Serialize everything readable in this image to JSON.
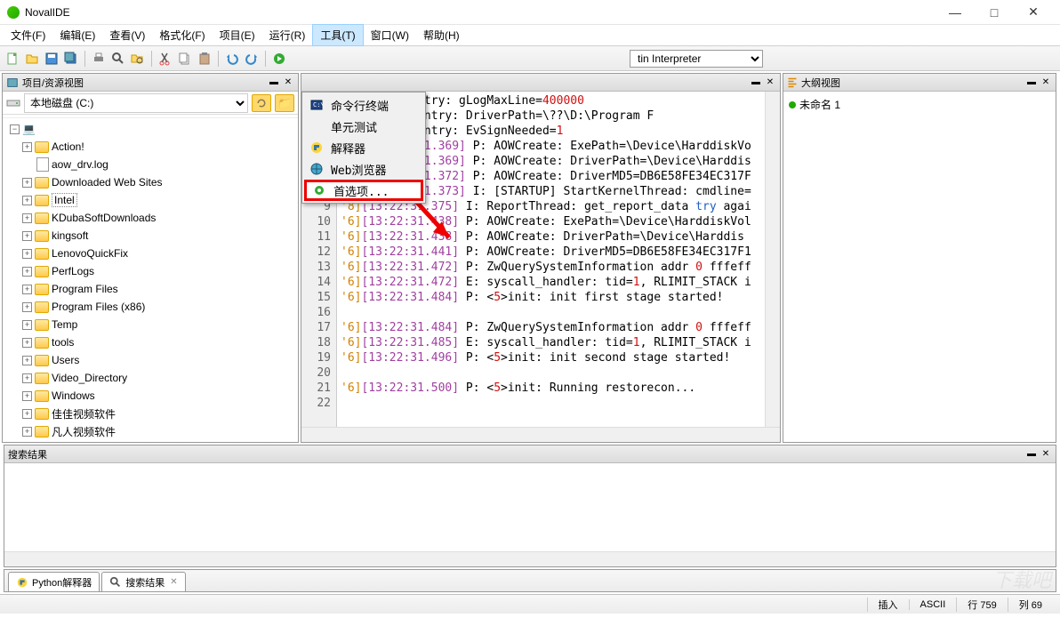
{
  "window": {
    "title": "NovalIDE"
  },
  "menubar": [
    "文件(F)",
    "编辑(E)",
    "查看(V)",
    "格式化(F)",
    "项目(E)",
    "运行(R)",
    "工具(T)",
    "窗口(W)",
    "帮助(H)"
  ],
  "menubar_active_index": 6,
  "interpreter": {
    "selected": "tin Interpreter"
  },
  "dropdown": {
    "items": [
      {
        "label": "命令行终端",
        "icon": "terminal"
      },
      {
        "label": "单元测试",
        "icon": ""
      },
      {
        "label": "解释器",
        "icon": "python"
      },
      {
        "label": "Web浏览器",
        "icon": "globe"
      },
      {
        "label": "首选项...",
        "icon": "pref",
        "highlighted": true
      }
    ]
  },
  "left_panel": {
    "title": "项目/资源视图",
    "drive": "本地磁盘 (C:)",
    "items": [
      {
        "label": "Action!",
        "type": "folder",
        "expandable": true
      },
      {
        "label": "aow_drv.log",
        "type": "file",
        "expandable": false
      },
      {
        "label": "Downloaded Web Sites",
        "type": "folder",
        "expandable": true
      },
      {
        "label": "Intel",
        "type": "folder",
        "expandable": true,
        "selected": true
      },
      {
        "label": "KDubaSoftDownloads",
        "type": "folder",
        "expandable": true
      },
      {
        "label": "kingsoft",
        "type": "folder",
        "expandable": true
      },
      {
        "label": "LenovoQuickFix",
        "type": "folder",
        "expandable": true
      },
      {
        "label": "PerfLogs",
        "type": "folder",
        "expandable": true
      },
      {
        "label": "Program Files",
        "type": "folder",
        "expandable": true
      },
      {
        "label": "Program Files (x86)",
        "type": "folder",
        "expandable": true
      },
      {
        "label": "Temp",
        "type": "folder",
        "expandable": true
      },
      {
        "label": "tools",
        "type": "folder",
        "expandable": true
      },
      {
        "label": "Users",
        "type": "folder",
        "expandable": true
      },
      {
        "label": "Video_Directory",
        "type": "folder",
        "expandable": true
      },
      {
        "label": "Windows",
        "type": "folder",
        "expandable": true
      },
      {
        "label": "佳佳视频软件",
        "type": "folder",
        "expandable": true
      },
      {
        "label": "凡人视频软件",
        "type": "folder",
        "expandable": true
      }
    ]
  },
  "outline": {
    "title": "大纲视图",
    "item": "未命名 1"
  },
  "editor": {
    "first_line": 2,
    "lines": [
      {
        "pre": "",
        "ts": "",
        "body_parts": [
          [
            " P: DriverEntry: gLogMaxLine=",
            "black"
          ],
          [
            "400000",
            "red"
          ]
        ]
      },
      {
        "pre": "",
        "ts": "",
        "body_parts": [
          [
            "] P: DriverEntry: DriverPath=\\??\\D:\\Program F",
            "black"
          ]
        ]
      },
      {
        "pre": "",
        "ts": "",
        "body_parts": [
          [
            "] P: DriverEntry: EvSignNeeded=",
            "black"
          ],
          [
            "1",
            "red"
          ]
        ]
      },
      {
        "pre": "'80]",
        "ts": "[13:22:31.369]",
        "body_parts": [
          [
            " P: AOWCreate: ExePath=\\Device\\HarddiskVo",
            "black"
          ]
        ]
      },
      {
        "pre": "'80]",
        "ts": "[13:22:31.369]",
        "body_parts": [
          [
            " P: AOWCreate: DriverPath=\\Device\\Harddis",
            "black"
          ]
        ]
      },
      {
        "pre": "'80]",
        "ts": "[13:22:31.372]",
        "body_parts": [
          [
            " P: AOWCreate: DriverMD5=DB6E58FE34EC317F",
            "black"
          ]
        ]
      },
      {
        "pre": "'80]",
        "ts": "[13:22:31.373]",
        "body_parts": [
          [
            " I: [STARTUP] StartKernelThread: cmdline=",
            "black"
          ]
        ]
      },
      {
        "pre": "'8]",
        "ts": "[13:22:31.375]",
        "body_parts": [
          [
            " I: ReportThread: get_report_data ",
            "black"
          ],
          [
            "try",
            "blue"
          ],
          [
            " agai",
            "black"
          ]
        ]
      },
      {
        "pre": "'6]",
        "ts": "[13:22:31.438]",
        "body_parts": [
          [
            " P: AOWCreate: ExePath=\\Device\\HarddiskVol",
            "black"
          ]
        ]
      },
      {
        "pre": "'6]",
        "ts": "[13:22:31.438]",
        "body_parts": [
          [
            " P: AOWCreate: DriverPath=\\Device\\Harddis",
            "black"
          ]
        ]
      },
      {
        "pre": "'6]",
        "ts": "[13:22:31.441]",
        "body_parts": [
          [
            " P: AOWCreate: DriverMD5=DB6E58FE34EC317F1",
            "black"
          ]
        ]
      },
      {
        "pre": "'6]",
        "ts": "[13:22:31.472]",
        "body_parts": [
          [
            " P: ZwQuerySystemInformation addr ",
            "black"
          ],
          [
            "0",
            "red"
          ],
          [
            " fffeff",
            "black"
          ]
        ]
      },
      {
        "pre": "'6]",
        "ts": "[13:22:31.472]",
        "body_parts": [
          [
            " E: syscall_handler: tid=",
            "black"
          ],
          [
            "1",
            "red"
          ],
          [
            ", RLIMIT_STACK i",
            "black"
          ]
        ]
      },
      {
        "pre": "'6]",
        "ts": "[13:22:31.484]",
        "body_parts": [
          [
            " P: <",
            "black"
          ],
          [
            "5",
            "red"
          ],
          [
            ">init: init first stage started!",
            "black"
          ]
        ]
      },
      {
        "pre": "",
        "ts": "",
        "body_parts": [
          [
            "",
            "black"
          ]
        ]
      },
      {
        "pre": "'6]",
        "ts": "[13:22:31.484]",
        "body_parts": [
          [
            " P: ZwQuerySystemInformation addr ",
            "black"
          ],
          [
            "0",
            "red"
          ],
          [
            " fffeff",
            "black"
          ]
        ]
      },
      {
        "pre": "'6]",
        "ts": "[13:22:31.485]",
        "body_parts": [
          [
            " E: syscall_handler: tid=",
            "black"
          ],
          [
            "1",
            "red"
          ],
          [
            ", RLIMIT_STACK i",
            "black"
          ]
        ]
      },
      {
        "pre": "'6]",
        "ts": "[13:22:31.496]",
        "body_parts": [
          [
            " P: <",
            "black"
          ],
          [
            "5",
            "red"
          ],
          [
            ">init: init second stage started!",
            "black"
          ]
        ]
      },
      {
        "pre": "",
        "ts": "",
        "body_parts": [
          [
            "",
            "black"
          ]
        ]
      },
      {
        "pre": "'6]",
        "ts": "[13:22:31.500]",
        "body_parts": [
          [
            " P: <",
            "black"
          ],
          [
            "5",
            "red"
          ],
          [
            ">init: Running restorecon...",
            "black"
          ]
        ]
      },
      {
        "pre": "",
        "ts": "",
        "body_parts": [
          [
            "",
            "black"
          ]
        ]
      }
    ]
  },
  "search": {
    "title": "搜索结果"
  },
  "tabs": [
    {
      "label": "Python解释器",
      "icon": "python"
    },
    {
      "label": "搜索结果",
      "icon": "search",
      "closable": true
    }
  ],
  "status": {
    "insert": "插入",
    "encoding": "ASCII",
    "line_label": "行",
    "line": "759",
    "col_label": "列",
    "col": "69"
  }
}
